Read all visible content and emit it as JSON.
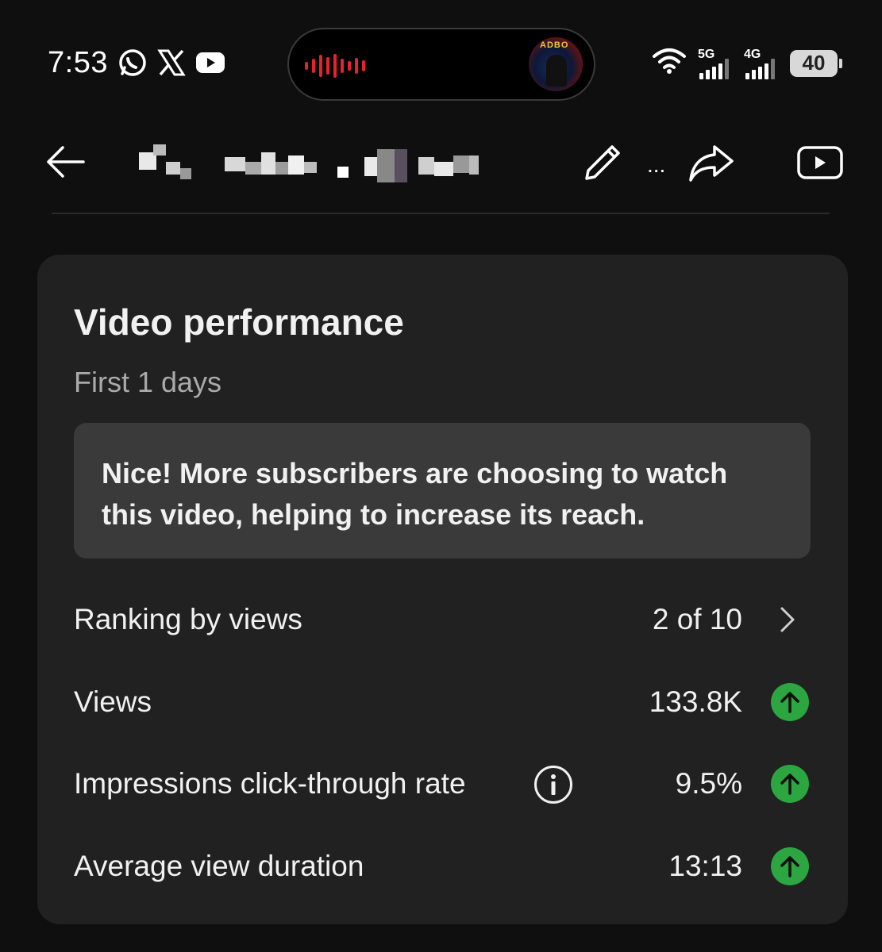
{
  "status_bar": {
    "time": "7:53",
    "app_icons": [
      "whatsapp-icon",
      "x-icon",
      "youtube-icon"
    ],
    "network_1": "5G",
    "network_2": "4G",
    "battery": "40"
  },
  "toolbar": {
    "back_icon": "arrow-left-icon",
    "title_ellipsis": "...",
    "actions": [
      "pencil-icon",
      "share-icon",
      "youtube-play-icon"
    ]
  },
  "card": {
    "title": "Video performance",
    "subtitle": "First 1 days",
    "insight": "Nice! More subscribers are choosing to watch this video, helping to increase its reach.",
    "ranking": {
      "label": "Ranking by views",
      "value": "2 of 10"
    },
    "metrics": [
      {
        "label": "Views",
        "value": "133.8K",
        "trend": "up"
      },
      {
        "label": "Impressions click-through rate",
        "value": "9.5%",
        "trend": "up"
      },
      {
        "label": "Average view duration",
        "value": "13:13",
        "trend": "up"
      }
    ]
  },
  "colors": {
    "background": "#0f0f0f",
    "card": "#212121",
    "insight_box": "#3a3a3a",
    "trend_up": "#2ba640",
    "waveform": "#e8212e"
  }
}
